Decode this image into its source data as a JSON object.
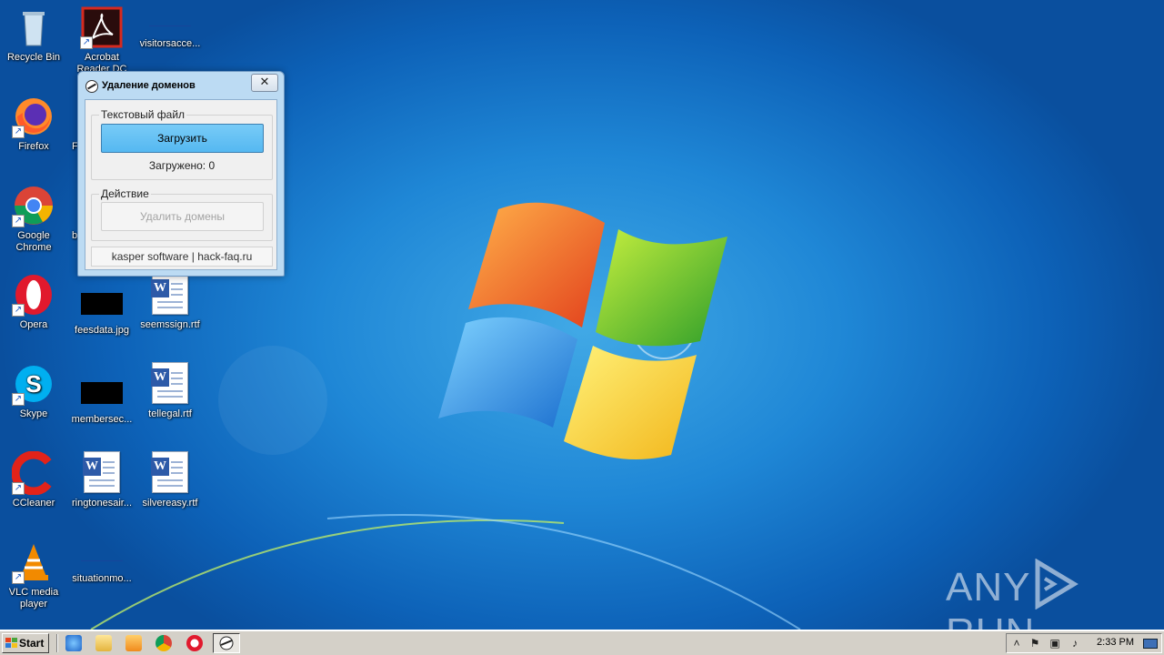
{
  "desktop": {
    "icons": [
      {
        "label": "Recycle Bin"
      },
      {
        "label": "Acrobat Reader DC"
      },
      {
        "label": "visitorsacce..."
      },
      {
        "label": "Firefox"
      },
      {
        "label": "F"
      },
      {
        "label": "Google Chrome"
      },
      {
        "label": "b"
      },
      {
        "label": "Opera"
      },
      {
        "label": "feesdata.jpg"
      },
      {
        "label": "seemssign.rtf"
      },
      {
        "label": "Skype"
      },
      {
        "label": "membersec..."
      },
      {
        "label": "tellegal.rtf"
      },
      {
        "label": "CCleaner"
      },
      {
        "label": "ringtonesair..."
      },
      {
        "label": "silvereasy.rtf"
      },
      {
        "label": "VLC media player"
      },
      {
        "label": "situationmo..."
      }
    ]
  },
  "dialog": {
    "title": "Удаление доменов",
    "close_glyph": "✕",
    "group_file": {
      "label": "Текстовый файл",
      "load_button": "Загрузить",
      "status": "Загружено: 0"
    },
    "group_action": {
      "label": "Действие",
      "delete_button": "Удалить домены"
    },
    "footer": "kasper software | hack-faq.ru"
  },
  "taskbar": {
    "start_label": "Start",
    "clock": "2:33 PM"
  },
  "watermark": {
    "left": "ANY",
    "right": "RUN"
  }
}
